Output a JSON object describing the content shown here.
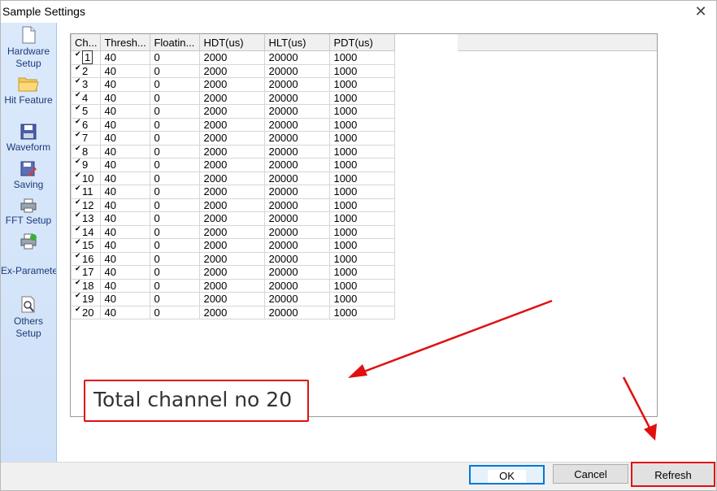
{
  "window": {
    "title": "Sample Settings",
    "close_glyph": "✕"
  },
  "sidebar": {
    "items": [
      {
        "label": "Hardware Setup",
        "icon": "document-icon"
      },
      {
        "label": "Hit Feature",
        "icon": "folder-icon"
      },
      {
        "label": "Waveform",
        "icon": "floppy-disk-icon"
      },
      {
        "label": "Saving",
        "icon": "save-edit-icon"
      },
      {
        "label": "FFT Setup",
        "icon": "printer-icon"
      },
      {
        "label": "Ex-Parameter Setup",
        "icon": "printer-check-icon"
      },
      {
        "label": "Others Setup",
        "icon": "print-preview-icon"
      }
    ]
  },
  "grid": {
    "columns": [
      "Ch...",
      "Thresh...",
      "Floatin...",
      "HDT(us)",
      "HLT(us)",
      "PDT(us)"
    ],
    "rows": [
      [
        "1",
        "40",
        "0",
        "2000",
        "20000",
        "1000"
      ],
      [
        "2",
        "40",
        "0",
        "2000",
        "20000",
        "1000"
      ],
      [
        "3",
        "40",
        "0",
        "2000",
        "20000",
        "1000"
      ],
      [
        "4",
        "40",
        "0",
        "2000",
        "20000",
        "1000"
      ],
      [
        "5",
        "40",
        "0",
        "2000",
        "20000",
        "1000"
      ],
      [
        "6",
        "40",
        "0",
        "2000",
        "20000",
        "1000"
      ],
      [
        "7",
        "40",
        "0",
        "2000",
        "20000",
        "1000"
      ],
      [
        "8",
        "40",
        "0",
        "2000",
        "20000",
        "1000"
      ],
      [
        "9",
        "40",
        "0",
        "2000",
        "20000",
        "1000"
      ],
      [
        "10",
        "40",
        "0",
        "2000",
        "20000",
        "1000"
      ],
      [
        "11",
        "40",
        "0",
        "2000",
        "20000",
        "1000"
      ],
      [
        "12",
        "40",
        "0",
        "2000",
        "20000",
        "1000"
      ],
      [
        "13",
        "40",
        "0",
        "2000",
        "20000",
        "1000"
      ],
      [
        "14",
        "40",
        "0",
        "2000",
        "20000",
        "1000"
      ],
      [
        "15",
        "40",
        "0",
        "2000",
        "20000",
        "1000"
      ],
      [
        "16",
        "40",
        "0",
        "2000",
        "20000",
        "1000"
      ],
      [
        "17",
        "40",
        "0",
        "2000",
        "20000",
        "1000"
      ],
      [
        "18",
        "40",
        "0",
        "2000",
        "20000",
        "1000"
      ],
      [
        "19",
        "40",
        "0",
        "2000",
        "20000",
        "1000"
      ],
      [
        "20",
        "40",
        "0",
        "2000",
        "20000",
        "1000"
      ]
    ],
    "checked": true
  },
  "annotation": {
    "text": "Total channel no 20",
    "color": "#e01010"
  },
  "buttons": {
    "ok": "OK",
    "cancel": "Cancel",
    "refresh": "Refresh"
  }
}
